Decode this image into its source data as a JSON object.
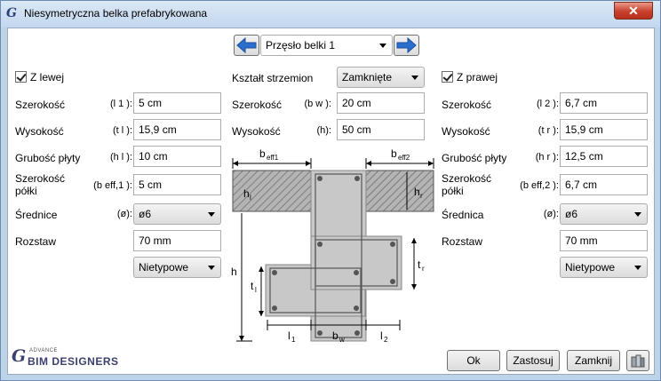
{
  "window": {
    "title": "Niesymetryczna belka prefabrykowana",
    "close_glyph": "✕",
    "app_glyph": "G"
  },
  "nav": {
    "span_value": "Przęsło belki 1"
  },
  "left": {
    "checkbox_label": "Z lewej",
    "width_label": "Szerokość",
    "width_sym": "(l 1 ):",
    "width_value": "5 cm",
    "height_label": "Wysokość",
    "height_sym": "(t l ):",
    "height_value": "15,9 cm",
    "plate_label": "Grubość płyty",
    "plate_sym": "(h l ):",
    "plate_value": "10 cm",
    "flange_label_1": "Szerokość",
    "flange_label_2": "półki",
    "flange_sym": "(b eff,1 ):",
    "flange_value": "5 cm",
    "diameter_label": "Średnice",
    "diameter_sym": "(ø):",
    "diameter_value": "ø6",
    "spacing_label": "Rozstaw",
    "spacing_value": "70 mm",
    "type_value": "Nietypowe"
  },
  "center": {
    "stirrup_label": "Kształt strzemion",
    "stirrup_value": "Zamknięte",
    "width_label": "Szerokość",
    "width_sym": "(b w ):",
    "width_value": "20 cm",
    "height_label": "Wysokość",
    "height_sym": "(h):",
    "height_value": "50 cm"
  },
  "right": {
    "checkbox_label": "Z prawej",
    "width_label": "Szerokość",
    "width_sym": "(l 2 ):",
    "width_value": "6,7 cm",
    "height_label": "Wysokość",
    "height_sym": "(t r ):",
    "height_value": "15,9 cm",
    "plate_label": "Grubość płyty",
    "plate_sym": "(h r ):",
    "plate_value": "12,5 cm",
    "flange_label_1": "Szerokość",
    "flange_label_2": "półki",
    "flange_sym": "(b eff,2 ):",
    "flange_value": "6,7 cm",
    "diameter_label": "Średnica",
    "diameter_sym": "(ø):",
    "diameter_value": "ø6",
    "spacing_label": "Rozstaw",
    "spacing_value": "70 mm",
    "type_value": "Nietypowe"
  },
  "diagram": {
    "beff1": "b",
    "beff1_sub": "eff1",
    "beff2": "b",
    "beff2_sub": "eff2",
    "hl": "h",
    "hl_sub": "l",
    "hr": "h",
    "hr_sub": "r",
    "h": "h",
    "tl": "t",
    "tl_sub": "l",
    "tr": "t",
    "tr_sub": "r",
    "l1": "l",
    "l1_sub": "1",
    "bw": "b",
    "bw_sub": "w",
    "l2": "l",
    "l2_sub": "2"
  },
  "footer": {
    "logo_small": "ADVANCE",
    "logo_main": "BIM DESIGNERS",
    "ok_label": "Ok",
    "apply_label": "Zastosuj",
    "close_label": "Zamknij"
  },
  "colors": {
    "title_bg": "#c2d7ee",
    "close_red": "#c7402b",
    "hatch": "#b0b0b0",
    "section_fill": "#c8c8c8",
    "logo": "#3b3f6e"
  }
}
